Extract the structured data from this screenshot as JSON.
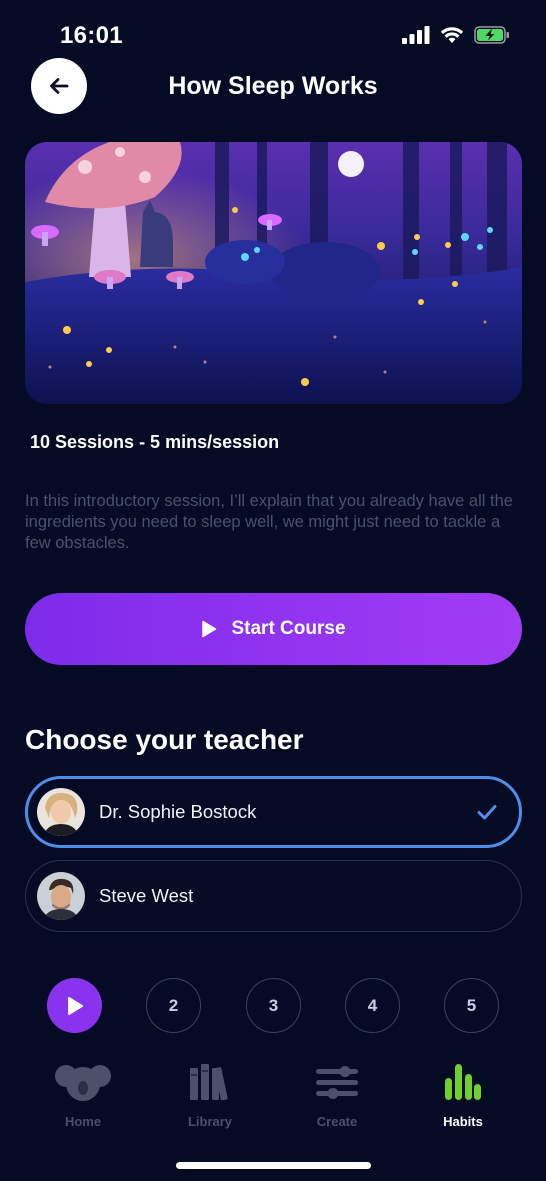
{
  "status_bar": {
    "time": "16:01"
  },
  "header": {
    "title": "How Sleep Works"
  },
  "course": {
    "meta": "10 Sessions - 5 mins/session",
    "description": "In this introductory session, I’ll explain that you already have all the ingredients you need to sleep well, we might just need to tackle a few obstacles.",
    "start_label": "Start Course"
  },
  "teachers": {
    "section_title": "Choose your teacher",
    "items": [
      {
        "name": "Dr. Sophie Bostock",
        "selected": true
      },
      {
        "name": "Steve West",
        "selected": false
      }
    ]
  },
  "sessions": {
    "items": [
      "",
      "2",
      "3",
      "4",
      "5"
    ],
    "active_index": 0
  },
  "tabs": [
    {
      "label": "Home",
      "icon": "koala-icon"
    },
    {
      "label": "Library",
      "icon": "books-icon"
    },
    {
      "label": "Create",
      "icon": "sliders-icon"
    },
    {
      "label": "Habits",
      "icon": "bar-chart-icon",
      "active": true
    }
  ],
  "colors": {
    "accent": "#8a33ef",
    "selected_border": "#4d8fe8",
    "habits_green": "#6fcf2c",
    "background": "#050b24"
  }
}
